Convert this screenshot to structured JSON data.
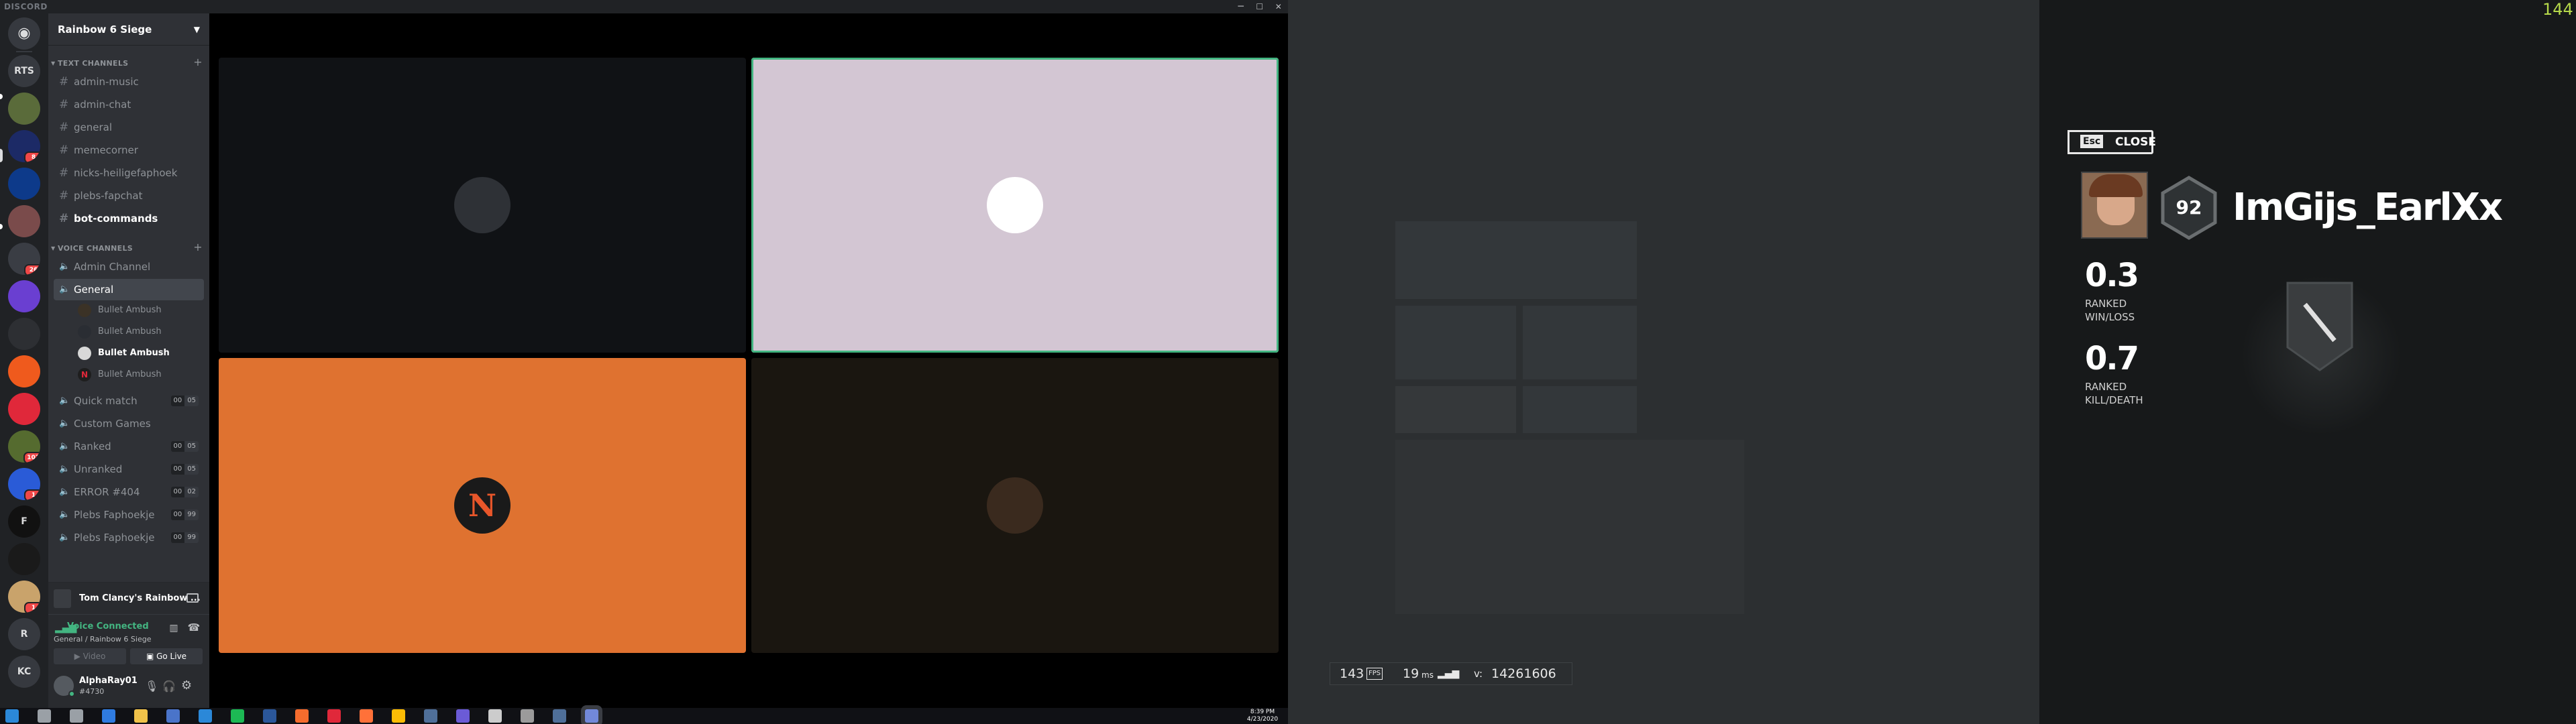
{
  "window": {
    "title": "DISCORD",
    "minimize_glyph": "─",
    "maximize_glyph": "☐",
    "close_glyph": "✕"
  },
  "servers": [
    {
      "initials": "",
      "icon": "discord-home-icon",
      "color": "#36393f"
    },
    {
      "initials": "RTS",
      "color": "#36393f"
    },
    {
      "initials": "",
      "color": "#5a6b3a"
    },
    {
      "initials": "",
      "color": "#1c2a66",
      "badge": "8"
    },
    {
      "initials": "",
      "color": "#0d3a8a"
    },
    {
      "initials": "",
      "color": "#7a4b4b"
    },
    {
      "initials": "",
      "color": "#3a3d44",
      "badge": "26"
    },
    {
      "initials": "",
      "color": "#6a3fd1"
    },
    {
      "initials": "",
      "color": "#2d2f33"
    },
    {
      "initials": "",
      "color": "#ef5a1d"
    },
    {
      "initials": "",
      "color": "#e0283a"
    },
    {
      "initials": "",
      "color": "#556b2f",
      "badge": "103"
    },
    {
      "initials": "",
      "color": "#2a5bd7",
      "badge": "1"
    },
    {
      "initials": "F",
      "color": "#111111"
    },
    {
      "initials": "",
      "color": "#1a1a1a"
    },
    {
      "initials": "",
      "color": "#c9a36b",
      "badge": "1"
    },
    {
      "initials": "R",
      "color": "#36393f"
    },
    {
      "initials": "KC",
      "color": "#36393f"
    }
  ],
  "guild": {
    "name": "Rainbow 6 Siege"
  },
  "categories": {
    "text": "TEXT CHANNELS",
    "voice": "VOICE CHANNELS",
    "add_glyph": "+"
  },
  "text_channels": [
    {
      "name": "admin-music",
      "unread": false
    },
    {
      "name": "admin-chat",
      "unread": false
    },
    {
      "name": "general",
      "unread": false
    },
    {
      "name": "memecorner",
      "unread": false
    },
    {
      "name": "nicks-heiligefaphoek",
      "unread": false
    },
    {
      "name": "plebs-fapchat",
      "unread": false
    },
    {
      "name": "bot-commands",
      "unread": true
    }
  ],
  "voice_channels": [
    {
      "name": "Admin Channel"
    },
    {
      "name": "General",
      "active": true,
      "members": [
        {
          "name": "Bullet Ambush",
          "avatar_color": "#3b3226"
        },
        {
          "name": "Bullet Ambush",
          "avatar_color": "#2a2d33"
        },
        {
          "name": "Bullet Ambush",
          "avatar_color": "#d8d8d8",
          "highlight": true
        },
        {
          "name": "Bullet Ambush",
          "avatar_color": "#1e1e1e",
          "avatar_letter": "N"
        }
      ]
    },
    {
      "name": "Quick match",
      "count": "00",
      "limit": "05"
    },
    {
      "name": "Custom Games"
    },
    {
      "name": "Ranked",
      "count": "00",
      "limit": "05"
    },
    {
      "name": "Unranked",
      "count": "00",
      "limit": "05"
    },
    {
      "name": "ERROR #404",
      "count": "00",
      "limit": "02"
    },
    {
      "name": "Plebs Faphoekje",
      "count": "00",
      "limit": "99"
    },
    {
      "name": "Plebs Faphoekje",
      "count": "00",
      "limit": "99"
    }
  ],
  "channel_glyphs": {
    "text": "#",
    "voice": "🔈"
  },
  "stream_status": {
    "game": "Tom Clancy's Rainbow ..."
  },
  "voice_status": {
    "state": "Voice Connected",
    "location": "General / Rainbow 6 Siege",
    "video_label": "Video",
    "golive_label": "Go Live"
  },
  "user": {
    "name": "AlphaRay01",
    "tag": "#4730"
  },
  "call_tiles": [
    {
      "bg": "#101215",
      "avatar_color": "#2e3136",
      "border": false
    },
    {
      "bg": "#d3c6d3",
      "avatar_color": "#ffffff",
      "border": true
    },
    {
      "bg": "#df7230",
      "avatar_color": "#1a1a1a",
      "avatar_letter": "N",
      "border": false
    },
    {
      "bg": "#1a1610",
      "avatar_color": "#3a2a1e",
      "border": false
    }
  ],
  "game": {
    "fps_counter": "144",
    "close_key": "Esc",
    "close_label": "CLOSE",
    "player_level": "92",
    "player_name": "ImGijs_EarlXx",
    "stats": [
      {
        "value": "0.3",
        "label_line1": "RANKED",
        "label_line2": "WIN/LOSS"
      },
      {
        "value": "0.7",
        "label_line1": "RANKED",
        "label_line2": "KILL/DEATH"
      }
    ],
    "perf": {
      "fps": "143",
      "fps_unit": "FPS",
      "ping": "19",
      "ping_unit": "ms",
      "version_label": "v:",
      "version": "14261606"
    }
  },
  "taskbar": {
    "time": "8:39 PM",
    "date": "4/23/2020",
    "apps": [
      {
        "icon": "windows-start-icon",
        "color": "#2b88d8"
      },
      {
        "icon": "search-icon",
        "color": "#9aa0a6"
      },
      {
        "icon": "task-view-icon",
        "color": "#9aa0a6"
      },
      {
        "icon": "edge-icon",
        "color": "#2f7be0"
      },
      {
        "icon": "file-explorer-icon",
        "color": "#f0c24a"
      },
      {
        "icon": "store-icon",
        "color": "#4a74c9"
      },
      {
        "icon": "mail-icon",
        "color": "#2b88d8"
      },
      {
        "icon": "spotify-icon",
        "color": "#1db954"
      },
      {
        "icon": "word-icon",
        "color": "#2b579a"
      },
      {
        "icon": "origin-icon",
        "color": "#f56c2d"
      },
      {
        "icon": "adobe-icon",
        "color": "#e0283a"
      },
      {
        "icon": "firefox-icon",
        "color": "#ff7139"
      },
      {
        "icon": "chrome-icon",
        "color": "#fbbc05"
      },
      {
        "icon": "steam-icon",
        "color": "#4f6f99"
      },
      {
        "icon": "obs-icon",
        "color": "#6b5bd6"
      },
      {
        "icon": "snip-icon",
        "color": "#cccccc"
      },
      {
        "icon": "uplay-icon",
        "color": "#9b9b9b"
      },
      {
        "icon": "steam-icon-2",
        "color": "#4f6f99"
      },
      {
        "icon": "discord-taskbar-icon",
        "color": "#7289da"
      }
    ]
  }
}
